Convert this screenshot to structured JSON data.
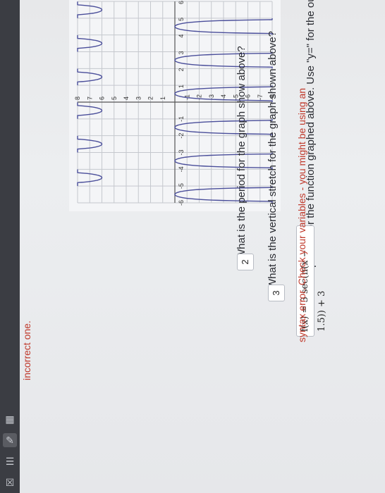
{
  "graph": {
    "x_ticks": [
      "-6",
      "-5",
      "-4",
      "-3",
      "-2",
      "-1",
      "1",
      "2",
      "3",
      "4",
      "5",
      "6"
    ],
    "y_ticks": [
      "8",
      "7",
      "6",
      "5",
      "4",
      "3",
      "2",
      "1",
      "-1",
      "-2",
      "-3",
      "-4",
      "-5",
      "-6",
      "-7",
      "-8"
    ]
  },
  "questions": {
    "q1": {
      "text": "What is the period for the graph show above?",
      "answer": "2"
    },
    "q2": {
      "text": "What is the vertical stretch for the graph shown above?",
      "answer": "3"
    },
    "q3": {
      "text": "Write an equation for the function graphed above. Use \"y=\" for the output."
    },
    "q4": {
      "formula": "f(x) = 3 sec(π(x − 1.5)) + 3",
      "error_line1": "syntax error. Check your variables - you might be using an",
      "error_line2": "incorrect one."
    }
  },
  "chart_data": {
    "type": "line",
    "title": "",
    "xlabel": "",
    "ylabel": "",
    "xlim": [
      -6,
      6
    ],
    "ylim": [
      -8,
      8
    ],
    "grid": true,
    "series": [
      {
        "function": "3 sec(π(x − 1.5)) + 3"
      }
    ]
  }
}
